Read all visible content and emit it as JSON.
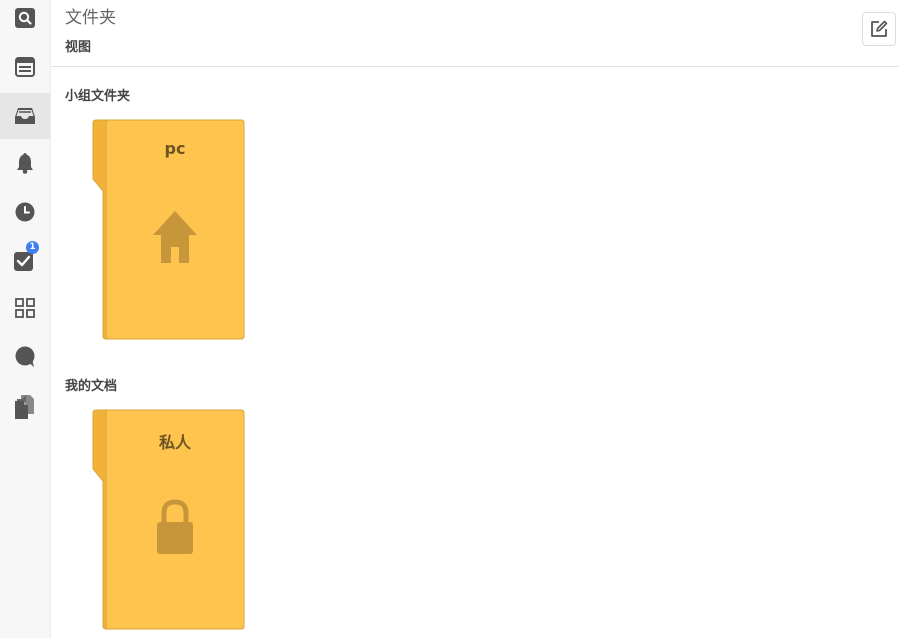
{
  "header": {
    "title": "文件夹",
    "view_label": "视图"
  },
  "sidebar": {
    "items": [
      {
        "icon": "search-icon"
      },
      {
        "icon": "browser-icon"
      },
      {
        "icon": "inbox-icon",
        "active": true
      },
      {
        "icon": "bell-icon"
      },
      {
        "icon": "clock-icon"
      },
      {
        "icon": "checkbox-icon",
        "badge": "1"
      },
      {
        "icon": "apps-grid-icon"
      },
      {
        "icon": "chat-bubble-icon"
      },
      {
        "icon": "documents-icon"
      }
    ]
  },
  "sections": {
    "group": {
      "heading": "小组文件夹",
      "folder_label": "pc",
      "folder_icon": "home-icon"
    },
    "mine": {
      "heading": "我的文档",
      "folder_label": "私人",
      "folder_icon": "lock-icon"
    }
  },
  "colors": {
    "folder_fill": "#ffc44d",
    "folder_border": "#d9a53a",
    "folder_icon": "#c8963a",
    "sidebar_icon": "#555555",
    "badge": "#3d7ff0"
  }
}
